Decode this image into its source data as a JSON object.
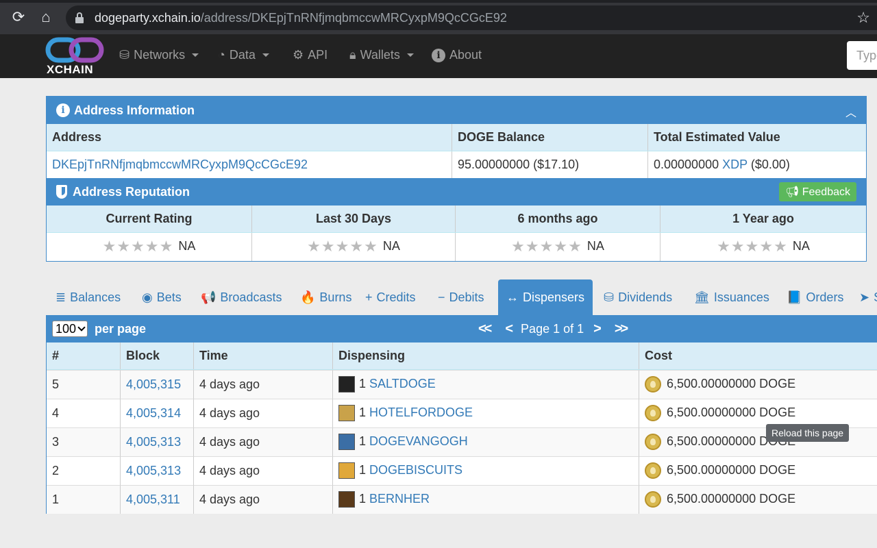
{
  "browser": {
    "url_host": "dogeparty.xchain.io",
    "url_path": "/address/DKEpjTnRNfjmqbmccwMRCyxpM9QcCGcE92",
    "tooltip": "Reload this page"
  },
  "navbar": {
    "logo_text": "XCHAIN",
    "items": [
      {
        "label": "Networks",
        "icon": "database-icon"
      },
      {
        "label": "Data",
        "icon": "dashboard-icon"
      },
      {
        "label": "API",
        "icon": "gears-icon"
      },
      {
        "label": "Wallets",
        "icon": "lock-icon"
      },
      {
        "label": "About",
        "icon": "info-icon"
      }
    ],
    "search_placeholder": "Type"
  },
  "address_info": {
    "title": "Address Information",
    "headers": [
      "Address",
      "DOGE Balance",
      "Total Estimated Value"
    ],
    "address": "DKEpjTnRNfjmqbmccwMRCyxpM9QcCGcE92",
    "doge_balance": "95.00000000 ($17.10)",
    "est_value_amount": "0.00000000",
    "est_value_asset": "XDP",
    "est_value_usd": "($0.00)"
  },
  "reputation": {
    "title": "Address Reputation",
    "feedback_label": "Feedback",
    "headers": [
      "Current Rating",
      "Last 30 Days",
      "6 months ago",
      "1 Year ago"
    ],
    "values": [
      "NA",
      "NA",
      "NA",
      "NA"
    ]
  },
  "tabs": [
    {
      "label": "Balances",
      "icon": "≣"
    },
    {
      "label": "Bets",
      "icon": "◉"
    },
    {
      "label": "Broadcasts",
      "icon": "📢"
    },
    {
      "label": "Burns",
      "icon": "🔥"
    },
    {
      "label": "Credits",
      "icon": "+"
    },
    {
      "label": "Debits",
      "icon": "−"
    },
    {
      "label": "Dispensers",
      "icon": "↔",
      "active": true
    },
    {
      "label": "Dividends",
      "icon": "⛁"
    },
    {
      "label": "Issuances",
      "icon": "🏛"
    },
    {
      "label": "Orders",
      "icon": "📘"
    },
    {
      "label": "S",
      "icon": "➤"
    }
  ],
  "dispensers": {
    "per_page_value": "100",
    "per_page_label": "per page",
    "page_text": "Page 1 of 1",
    "headers": [
      "#",
      "Block",
      "Time",
      "Dispensing",
      "Cost"
    ],
    "rows": [
      {
        "num": "5",
        "block": "4,005,315",
        "time": "4 days ago",
        "qty": "1",
        "asset": "SALTDOGE",
        "cost": "6,500.00000000 DOGE",
        "color": "#222"
      },
      {
        "num": "4",
        "block": "4,005,314",
        "time": "4 days ago",
        "qty": "1",
        "asset": "HOTELFORDOGE",
        "cost": "6,500.00000000 DOGE",
        "color": "#c9a24a"
      },
      {
        "num": "3",
        "block": "4,005,313",
        "time": "4 days ago",
        "qty": "1",
        "asset": "DOGEVANGOGH",
        "cost": "6,500.00000000 DOGE",
        "color": "#3b6ea5"
      },
      {
        "num": "2",
        "block": "4,005,313",
        "time": "4 days ago",
        "qty": "1",
        "asset": "DOGEBISCUITS",
        "cost": "6,500.00000000 DOGE",
        "color": "#e0a83a"
      },
      {
        "num": "1",
        "block": "4,005,311",
        "time": "4 days ago",
        "qty": "1",
        "asset": "BERNHER",
        "cost": "6,500.00000000 DOGE",
        "color": "#5a3a1a"
      }
    ]
  }
}
